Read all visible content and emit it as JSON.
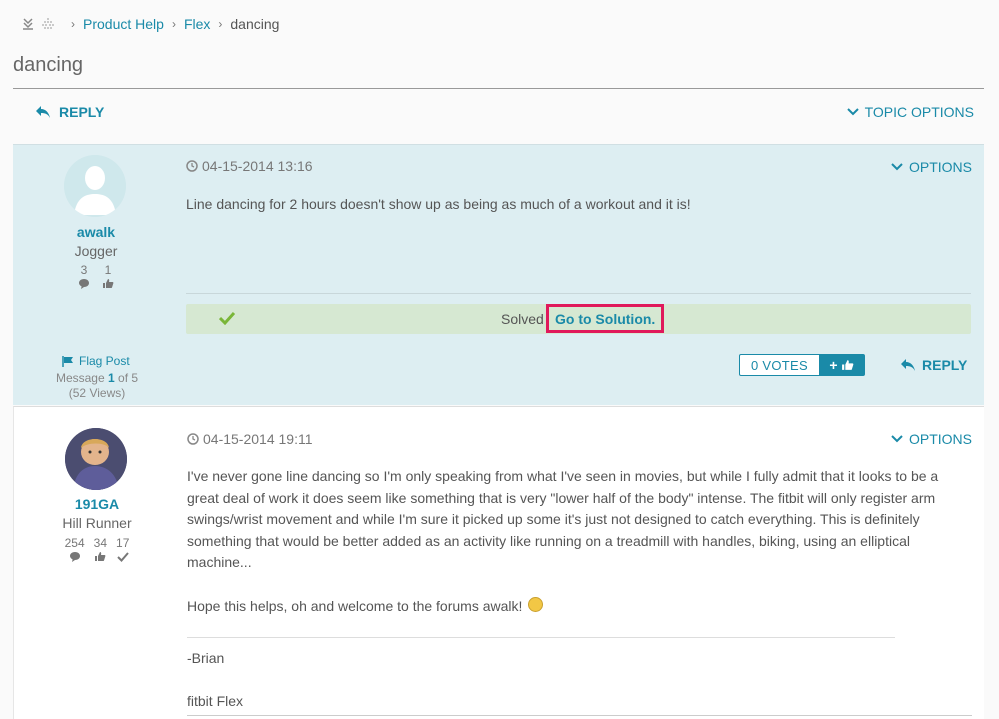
{
  "breadcrumb": {
    "items": [
      "Product Help",
      "Flex"
    ],
    "current": "dancing"
  },
  "page_title": "dancing",
  "actions": {
    "reply": "REPLY",
    "topic_options": "TOPIC OPTIONS"
  },
  "posts": [
    {
      "user": "awalk",
      "rank": "Jogger",
      "stats": [
        "3",
        "1"
      ],
      "timestamp": "04-15-2014 13:16",
      "options": "OPTIONS",
      "body": "Line dancing for 2 hours doesn't show up as being as much of a workout and it is!",
      "solved_label": "Solved",
      "goto_solution": "Go to Solution.",
      "flag": "Flag Post",
      "message_prefix": "Message",
      "message_index": "1",
      "message_suffix": "of 5",
      "views": "(52 Views)",
      "votes": "0 VOTES",
      "vote_plus": "+",
      "reply": "REPLY"
    },
    {
      "user": "191GA",
      "rank": "Hill Runner",
      "stats": [
        "254",
        "34",
        "17"
      ],
      "timestamp": "04-15-2014 19:11",
      "options": "OPTIONS",
      "body": "I've never gone line dancing so I'm only speaking from what I've seen in movies, but while I fully admit that it looks to be a great deal of work it does seem like something that is very \"lower half of the body\" intense. The fitbit will only register arm swings/wrist movement and while I'm sure it picked up some it's just not designed to catch everything. This is definitely something that would be better added as an activity like running on a treadmill with handles, biking, using an elliptical machine...",
      "body2": "Hope this helps, oh and welcome to the forums awalk!",
      "signature": "-Brian",
      "device": "fitbit Flex"
    }
  ],
  "colors": {
    "accent": "#1a8aa8",
    "post_highlight": "#ddeef2",
    "solved_bg": "#d6e8d2",
    "highlight_border": "#e0195b"
  }
}
